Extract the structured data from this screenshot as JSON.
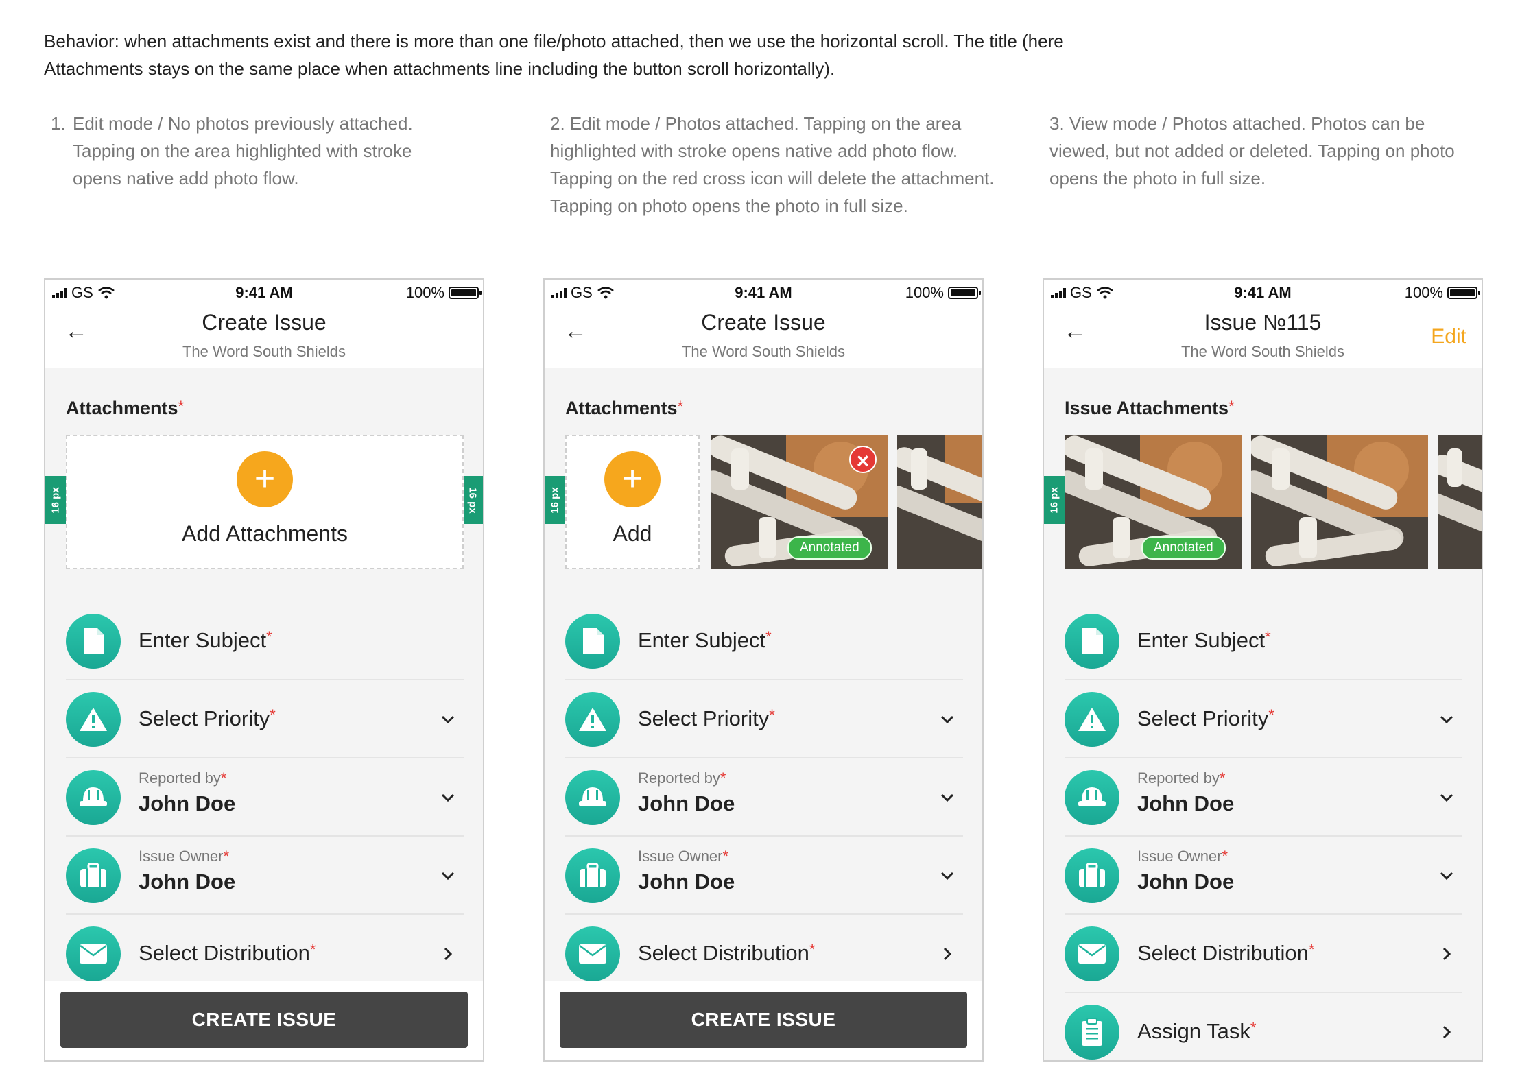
{
  "behavior_text": "Behavior: when attachments exist and there is more than one file/photo attached, then we use the horizontal scroll. The title (here Attachments stays on the same place when attachments line including the button scroll horizontally).",
  "captions": [
    {
      "number": "1.",
      "text": "Edit mode / No photos previously attached. Tapping on the area highlighted with stroke opens native add photo flow."
    },
    {
      "text": "2. Edit mode / Photos attached. Tapping on the area highlighted with stroke opens native add photo flow. Tapping on the red cross icon will delete the attachment. Tapping on photo opens the photo in full size."
    },
    {
      "text": "3. View mode / Photos attached. Photos can be viewed, but not added or deleted. Tapping on photo opens the photo in full size."
    }
  ],
  "status_bar": {
    "carrier": "GS",
    "time": "9:41 AM",
    "battery": "100%"
  },
  "required_mark": "*",
  "spacing_tag": "16 px",
  "screens": [
    {
      "nav": {
        "back": "←",
        "title": "Create Issue",
        "subtitle": "The Word South Shields"
      },
      "attachments_label": "Attachments",
      "add_label": "Add Attachments",
      "button": "CREATE ISSUE"
    },
    {
      "nav": {
        "back": "←",
        "title": "Create Issue",
        "subtitle": "The Word South Shields"
      },
      "attachments_label": "Attachments",
      "add_label": "Add",
      "annotated_badge": "Annotated",
      "button": "CREATE ISSUE"
    },
    {
      "nav": {
        "back": "←",
        "title": "Issue №115",
        "subtitle": "The Word South Shields",
        "edit": "Edit"
      },
      "attachments_label": "Issue Attachments",
      "annotated_badge": "Annotated"
    }
  ],
  "fields": {
    "subject": "Enter Subject",
    "priority": "Select Priority",
    "reported_by_label": "Reported by",
    "reported_by_value": "John Doe",
    "owner_label": "Issue Owner",
    "owner_value": "John Doe",
    "distribution": "Select Distribution",
    "assign_task": "Assign Task"
  },
  "colors": {
    "accent_teal": "#1fb59d",
    "accent_orange": "#f6a71d",
    "required_red": "#e53935",
    "annotated_green": "#3cb54a",
    "spacing_tag": "#1a9c74",
    "button_dark": "#454545"
  }
}
